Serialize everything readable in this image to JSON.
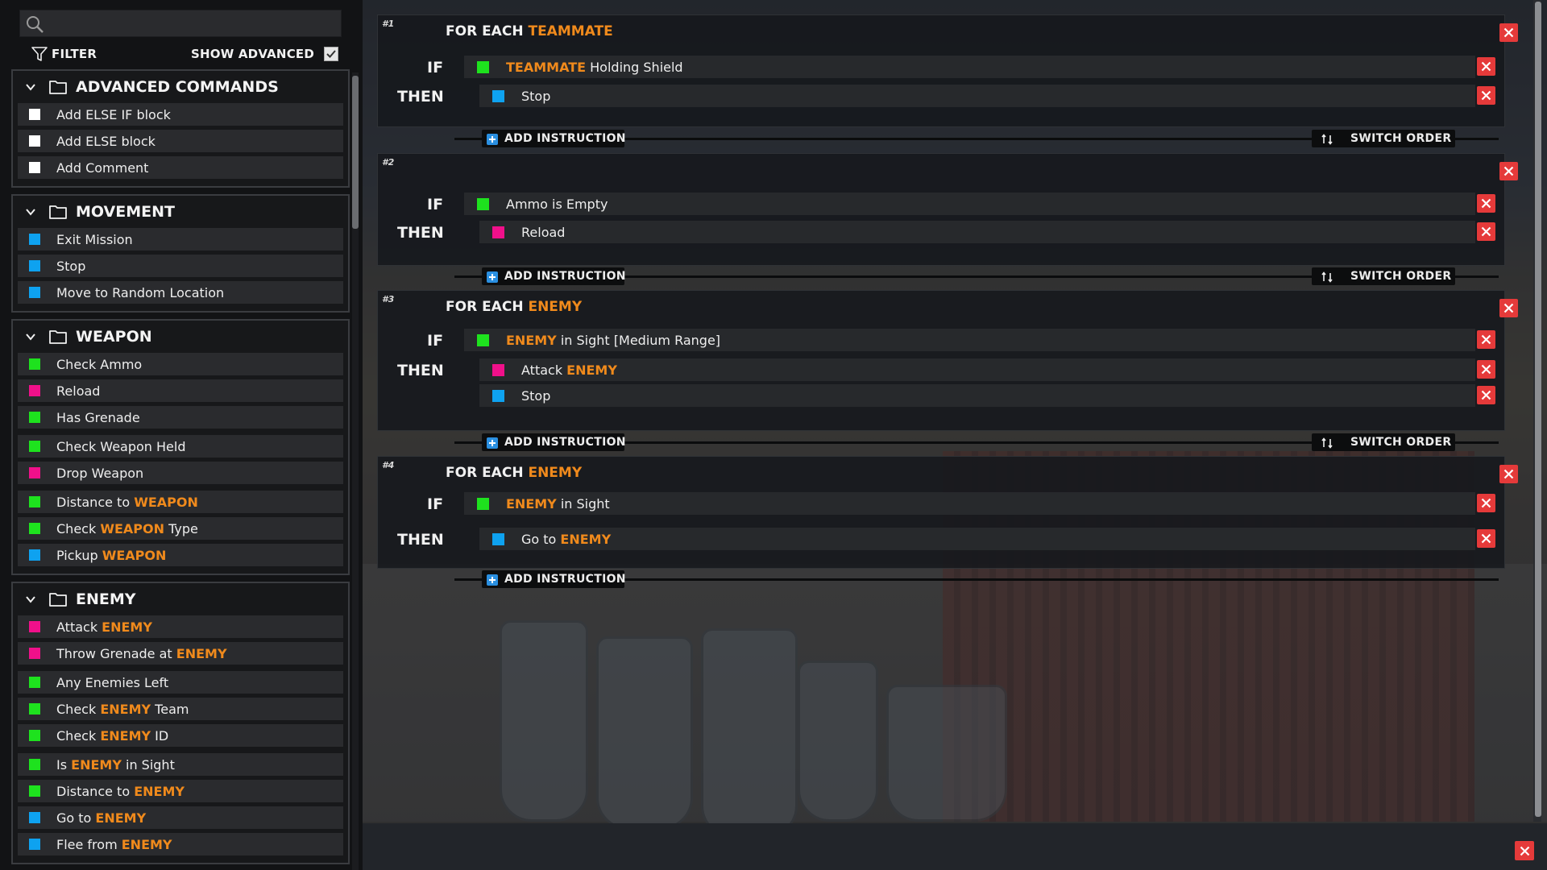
{
  "search": {
    "placeholder": "",
    "value": ""
  },
  "filter": {
    "label": "FILTER"
  },
  "show_advanced": {
    "label": "SHOW ADVANCED",
    "checked": true
  },
  "colors": {
    "condition": "#1ee21e",
    "action_blue": "#0ea2f0",
    "action_pink": "#f0108a",
    "comment_white": "#ffffff",
    "highlight": "#f08a1c",
    "delete": "#e53a3a"
  },
  "categories": [
    {
      "title": "ADVANCED COMMANDS",
      "items": [
        {
          "color": "white",
          "parts": [
            {
              "t": "Add ELSE IF block"
            }
          ]
        },
        {
          "color": "white",
          "parts": [
            {
              "t": "Add ELSE block"
            }
          ]
        },
        {
          "color": "white",
          "parts": [
            {
              "t": "Add Comment"
            }
          ]
        }
      ]
    },
    {
      "title": "MOVEMENT",
      "items": [
        {
          "color": "blue",
          "parts": [
            {
              "t": "Exit Mission"
            }
          ]
        },
        {
          "color": "blue",
          "parts": [
            {
              "t": "Stop"
            }
          ]
        },
        {
          "color": "blue",
          "parts": [
            {
              "t": "Move to Random Location"
            }
          ]
        }
      ]
    },
    {
      "title": "WEAPON",
      "items": [
        {
          "color": "green",
          "parts": [
            {
              "t": "Check Ammo"
            }
          ]
        },
        {
          "color": "pink",
          "parts": [
            {
              "t": "Reload"
            }
          ]
        },
        {
          "color": "green",
          "parts": [
            {
              "t": "Has Grenade"
            }
          ]
        },
        {
          "color": "green",
          "gap": true,
          "parts": [
            {
              "t": "Check Weapon Held"
            }
          ]
        },
        {
          "color": "pink",
          "parts": [
            {
              "t": "Drop Weapon"
            }
          ]
        },
        {
          "color": "green",
          "gap": true,
          "parts": [
            {
              "t": "Distance to "
            },
            {
              "t": "WEAPON",
              "hl": true
            }
          ]
        },
        {
          "color": "green",
          "parts": [
            {
              "t": "Check "
            },
            {
              "t": "WEAPON",
              "hl": true
            },
            {
              "t": " Type"
            }
          ]
        },
        {
          "color": "blue",
          "parts": [
            {
              "t": "Pickup "
            },
            {
              "t": "WEAPON",
              "hl": true
            }
          ]
        }
      ]
    },
    {
      "title": "ENEMY",
      "items": [
        {
          "color": "pink",
          "parts": [
            {
              "t": "Attack "
            },
            {
              "t": "ENEMY",
              "hl": true
            }
          ]
        },
        {
          "color": "pink",
          "parts": [
            {
              "t": "Throw Grenade at "
            },
            {
              "t": "ENEMY",
              "hl": true
            }
          ]
        },
        {
          "color": "green",
          "gap": true,
          "parts": [
            {
              "t": "Any Enemies Left"
            }
          ]
        },
        {
          "color": "green",
          "parts": [
            {
              "t": "Check "
            },
            {
              "t": "ENEMY",
              "hl": true
            },
            {
              "t": " Team"
            }
          ]
        },
        {
          "color": "green",
          "parts": [
            {
              "t": "Check "
            },
            {
              "t": "ENEMY",
              "hl": true
            },
            {
              "t": " ID"
            }
          ]
        },
        {
          "color": "green",
          "gap": true,
          "parts": [
            {
              "t": "Is "
            },
            {
              "t": "ENEMY",
              "hl": true
            },
            {
              "t": " in Sight"
            }
          ]
        },
        {
          "color": "green",
          "parts": [
            {
              "t": "Distance to "
            },
            {
              "t": "ENEMY",
              "hl": true
            }
          ]
        },
        {
          "color": "blue",
          "parts": [
            {
              "t": "Go to "
            },
            {
              "t": "ENEMY",
              "hl": true
            }
          ]
        },
        {
          "color": "blue",
          "parts": [
            {
              "t": "Flee from "
            },
            {
              "t": "ENEMY",
              "hl": true
            }
          ]
        }
      ]
    }
  ],
  "keywords": {
    "if": "IF",
    "then": "THEN",
    "for_each": "FOR EACH "
  },
  "buttons": {
    "add_instruction": "ADD INSTRUCTION",
    "switch_order": "SWITCH ORDER"
  },
  "rules": [
    {
      "number": "#1",
      "for_each": "TEAMMATE",
      "conditions": [
        {
          "color": "green",
          "parts": [
            {
              "t": "TEAMMATE",
              "hl": true
            },
            {
              "t": " Holding Shield"
            }
          ]
        }
      ],
      "actions": [
        {
          "color": "blue",
          "parts": [
            {
              "t": "Stop"
            }
          ]
        }
      ],
      "switch_order": true
    },
    {
      "number": "#2",
      "for_each": "",
      "conditions": [
        {
          "color": "green",
          "parts": [
            {
              "t": "Ammo is Empty"
            }
          ]
        }
      ],
      "actions": [
        {
          "color": "pink",
          "parts": [
            {
              "t": "Reload"
            }
          ]
        }
      ],
      "switch_order": true
    },
    {
      "number": "#3",
      "for_each": "ENEMY",
      "conditions": [
        {
          "color": "green",
          "parts": [
            {
              "t": "ENEMY",
              "hl": true
            },
            {
              "t": " in Sight [Medium Range]"
            }
          ]
        }
      ],
      "actions": [
        {
          "color": "pink",
          "parts": [
            {
              "t": "Attack "
            },
            {
              "t": "ENEMY",
              "hl": true
            }
          ]
        },
        {
          "color": "blue",
          "parts": [
            {
              "t": "Stop"
            }
          ]
        }
      ],
      "switch_order": true
    },
    {
      "number": "#4",
      "for_each": "ENEMY",
      "conditions": [
        {
          "color": "green",
          "parts": [
            {
              "t": "ENEMY",
              "hl": true
            },
            {
              "t": " in Sight"
            }
          ]
        }
      ],
      "actions": [
        {
          "color": "blue",
          "parts": [
            {
              "t": "Go to "
            },
            {
              "t": "ENEMY",
              "hl": true
            }
          ]
        }
      ],
      "switch_order": false
    }
  ]
}
